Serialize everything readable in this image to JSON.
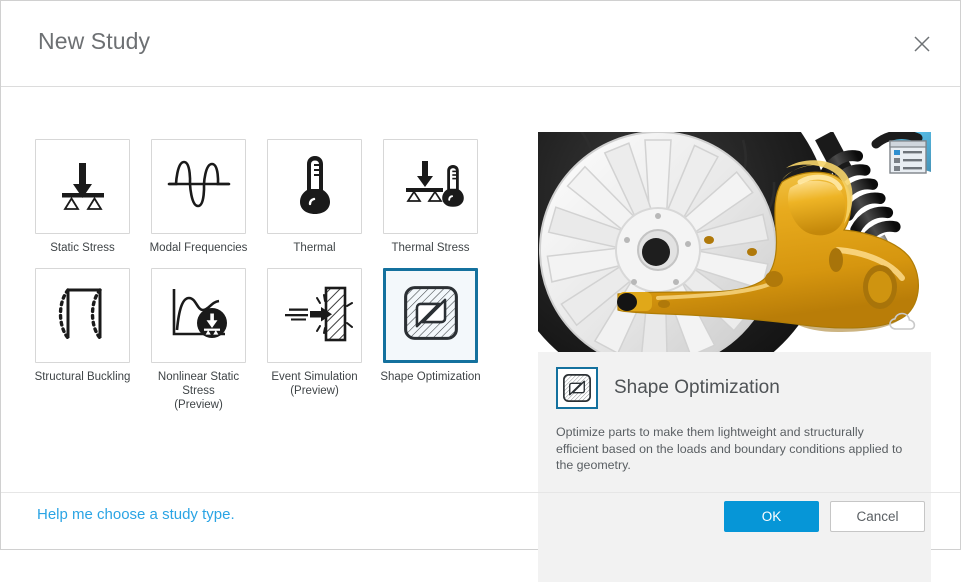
{
  "dialog": {
    "title": "New Study",
    "close_icon": "close-icon"
  },
  "studies": [
    {
      "id": "static-stress",
      "label": "Static Stress",
      "icon": "static-stress-icon",
      "selected": false
    },
    {
      "id": "modal-frequencies",
      "label": "Modal Frequencies",
      "icon": "modal-frequencies-icon",
      "selected": false
    },
    {
      "id": "thermal",
      "label": "Thermal",
      "icon": "thermal-icon",
      "selected": false
    },
    {
      "id": "thermal-stress",
      "label": "Thermal Stress",
      "icon": "thermal-stress-icon",
      "selected": false
    },
    {
      "id": "structural-buckling",
      "label": "Structural Buckling",
      "icon": "structural-buckling-icon",
      "selected": false
    },
    {
      "id": "nonlinear-static-stress",
      "label": "Nonlinear Static\nStress\n(Preview)",
      "icon": "nonlinear-static-stress-icon",
      "selected": false
    },
    {
      "id": "event-simulation",
      "label": "Event Simulation\n(Preview)",
      "icon": "event-simulation-icon",
      "selected": false
    },
    {
      "id": "shape-optimization",
      "label": "Shape Optimization",
      "icon": "shape-optimization-icon",
      "selected": true
    }
  ],
  "preview": {
    "hero_alt": "motorcycle-swingarm-render",
    "overlay_list_icon": "list-window-icon",
    "overlay_cloud_icon": "cloud-icon",
    "detail_icon": "shape-optimization-icon",
    "title": "Shape Optimization",
    "description": "Optimize parts to make them lightweight and structurally efficient based on the loads and boundary conditions applied to the geometry."
  },
  "footer": {
    "help_link": "Help me choose a study type.",
    "ok_label": "OK",
    "cancel_label": "Cancel"
  },
  "colors": {
    "accent_blue": "#0696d7",
    "selected_border": "#14719e",
    "link_blue": "#2aa4e4",
    "panel_bg": "#f2f2f2",
    "title_text": "#6d7073"
  }
}
